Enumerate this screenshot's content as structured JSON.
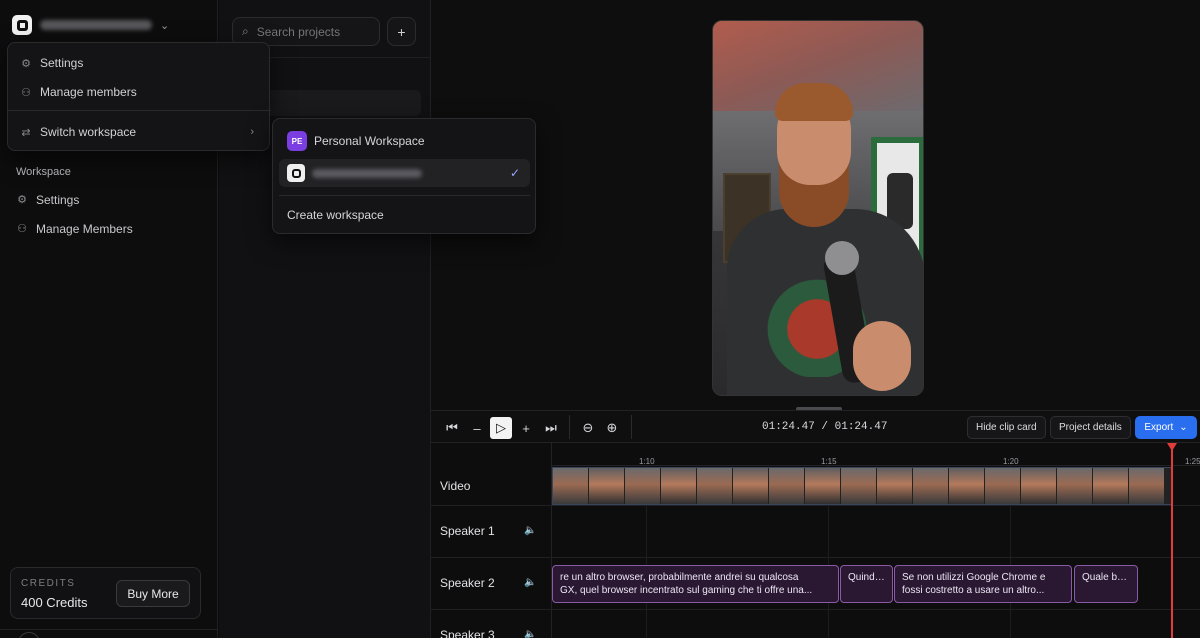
{
  "workspace": {
    "logo": "workspace-logo",
    "switcher_chevron": "⌄"
  },
  "menu": {
    "settings": "Settings",
    "manage_members": "Manage members",
    "switch_workspace": "Switch workspace"
  },
  "submenu": {
    "personal_badge": "PE",
    "personal_name": "Personal Workspace",
    "create": "Create workspace"
  },
  "sidebar": {
    "section_label": "Workspace",
    "items": [
      {
        "label": "Settings",
        "icon": "gear-icon"
      },
      {
        "label": "Manage Members",
        "icon": "users-icon"
      }
    ],
    "credits_label": "CREDITS",
    "credits_value": "400 Credits",
    "buy_more": "Buy More"
  },
  "projects": {
    "search_placeholder": "Search projects",
    "add": "+",
    "item_partial": "est"
  },
  "player": {
    "timecode": "01:24.47 / 01:24.47",
    "hide_clip_card": "Hide clip card",
    "project_details": "Project details",
    "export": "Export"
  },
  "timeline": {
    "ticks": [
      "1:10",
      "1:15",
      "1:20",
      "1:25"
    ],
    "tracks": [
      "Video",
      "Speaker 1",
      "Speaker 2",
      "Speaker 3"
    ],
    "clips": [
      {
        "line1": "re un altro browser, probabilmente andrei su qualcosa",
        "line2": "GX, quel browser incentrato sul gaming che ti offre una..."
      },
      {
        "line1": "Quindi ...",
        "line2": ""
      },
      {
        "line1": "Se non utilizzi Google Chrome e",
        "line2": "fossi costretto a usare un altro..."
      },
      {
        "line1": "Quale bro...",
        "line2": ""
      }
    ]
  },
  "colors": {
    "accent": "#2a6ef0",
    "playhead": "#e23b3b",
    "clip_border": "#8a5aa6",
    "personal_badge": "#7b3ee0"
  }
}
